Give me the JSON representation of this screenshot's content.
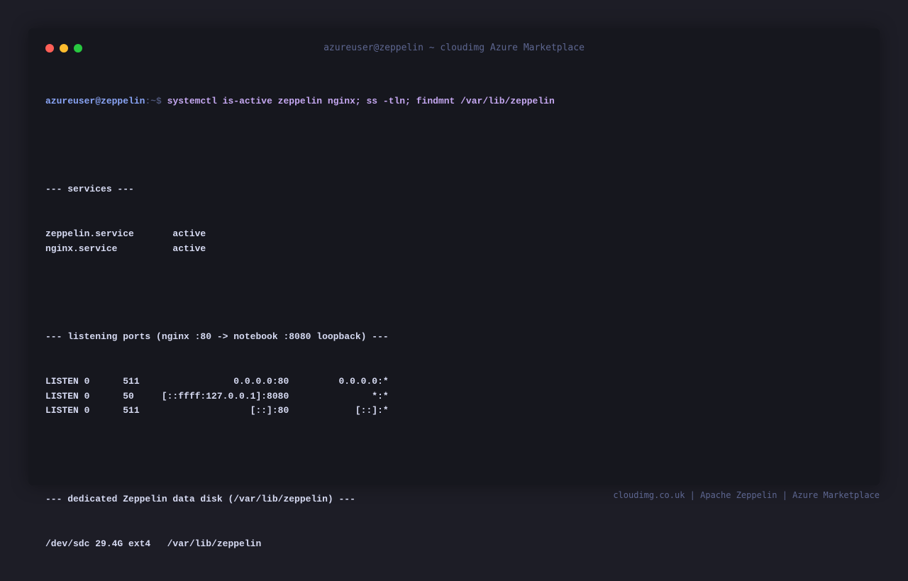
{
  "window": {
    "title": "azureuser@zeppelin ~ cloudimg Azure Marketplace"
  },
  "terminal": {
    "prompt_user": "azureuser@zeppelin",
    "prompt_path": ":~$ ",
    "command": "systemctl is-active zeppelin nginx; ss -tln; findmnt /var/lib/zeppelin",
    "services_header": "--- services ---",
    "services": [
      {
        "name": "zeppelin.service",
        "status": "active"
      },
      {
        "name": "nginx.service",
        "status": "active"
      }
    ],
    "ports_header": "--- listening ports (nginx :80 -> notebook :8080 loopback) ---",
    "ports": [
      {
        "state": "LISTEN",
        "recvq": "0",
        "sendq": "511",
        "local": "0.0.0.0:80",
        "peer": "0.0.0.0:*"
      },
      {
        "state": "LISTEN",
        "recvq": "0",
        "sendq": "50",
        "local": "[::ffff:127.0.0.1]:8080",
        "peer": "*:*"
      },
      {
        "state": "LISTEN",
        "recvq": "0",
        "sendq": "511",
        "local": "[::]:80",
        "peer": "[::]:*"
      }
    ],
    "disk_header": "--- dedicated Zeppelin data disk (/var/lib/zeppelin) ---",
    "disk": {
      "device": "/dev/sdc",
      "size": "29.4G",
      "fstype": "ext4",
      "target": "/var/lib/zeppelin"
    }
  },
  "footer": {
    "text": "cloudimg.co.uk | Apache Zeppelin | Azure Marketplace"
  },
  "colors": {
    "background": "#1d1d26",
    "window_bg": "#16171e",
    "prompt_user": "#89a4f5",
    "command": "#c4a7f0",
    "output": "#d6daf2",
    "title": "#5d6690",
    "close": "#ff5f57",
    "minimize": "#febc2e",
    "maximize": "#28c840"
  }
}
